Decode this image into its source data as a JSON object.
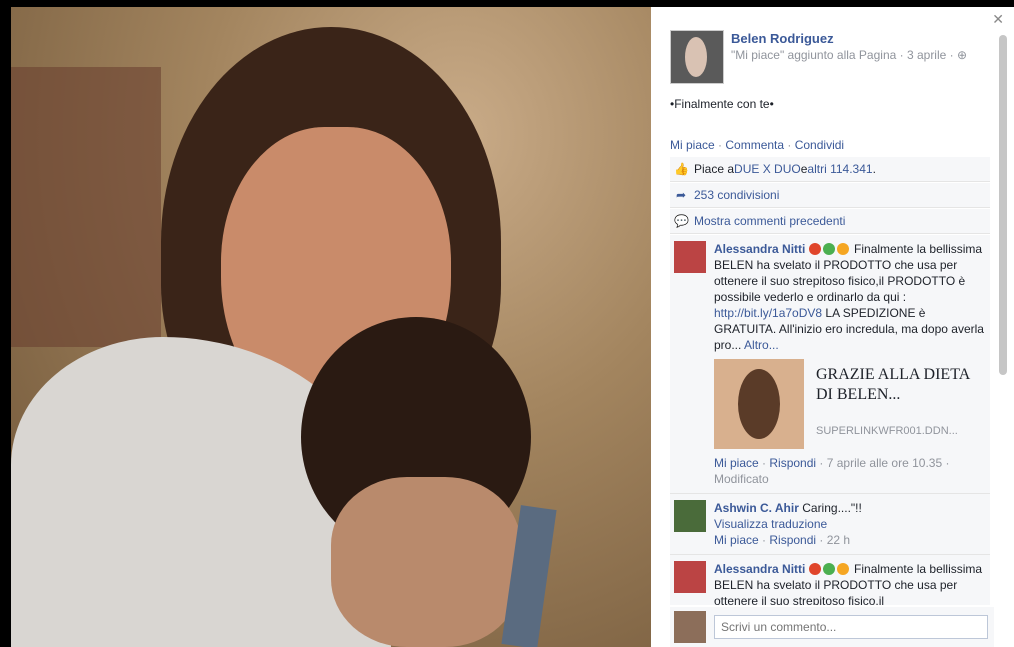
{
  "panel": {
    "author": "Belen Rodriguez",
    "meta": "\"Mi piace\" aggiunto alla Pagina · 3 aprile · ",
    "post_text": "•Finalmente con te•",
    "actions": {
      "like": "Mi piace",
      "comment": "Commenta",
      "share": "Condividi"
    },
    "likes_prefix": "Piace a ",
    "likes_link1": "DUE X DUO",
    "likes_mid": " e ",
    "likes_link2": "altri 114.341",
    "likes_suffix": ".",
    "shares": "253 condivisioni",
    "show_comments": "Mostra commenti precedenti",
    "reply_placeholder": "Scrivi un commento..."
  },
  "comments": [
    {
      "name": "Alessandra Nitti",
      "text_a": " Finalmente la bellissima BELEN ha svelato il PRODOTTO che usa per ottenere il suo strepitoso fisico,il PRODOTTO è possibile vederlo e ordinarlo da qui : ",
      "link": "http://bit.ly/1a7oDV8",
      "text_b": " LA SPEDIZIONE è GRATUITA. All'inizio ero incredula, ma dopo averla pro...",
      "more": " Altro...",
      "preview_title": "GRAZIE ALLA DIETA DI BELEN...",
      "preview_domain": "SUPERLINKWFR001.DDN...",
      "like": "Mi piace",
      "reply": "Rispondi",
      "time": " · 7 aprile alle ore 10.35 · Modificato"
    },
    {
      "name": "Ashwin C. Ahir",
      "text": " Caring....\"!!",
      "translate": "Visualizza traduzione",
      "like": "Mi piace",
      "reply": "Rispondi",
      "time": " · 22 h"
    },
    {
      "name": "Alessandra Nitti",
      "text": " Finalmente la bellissima BELEN ha svelato il PRODOTTO che usa per ottenere il suo strepitoso fisico,il"
    }
  ]
}
